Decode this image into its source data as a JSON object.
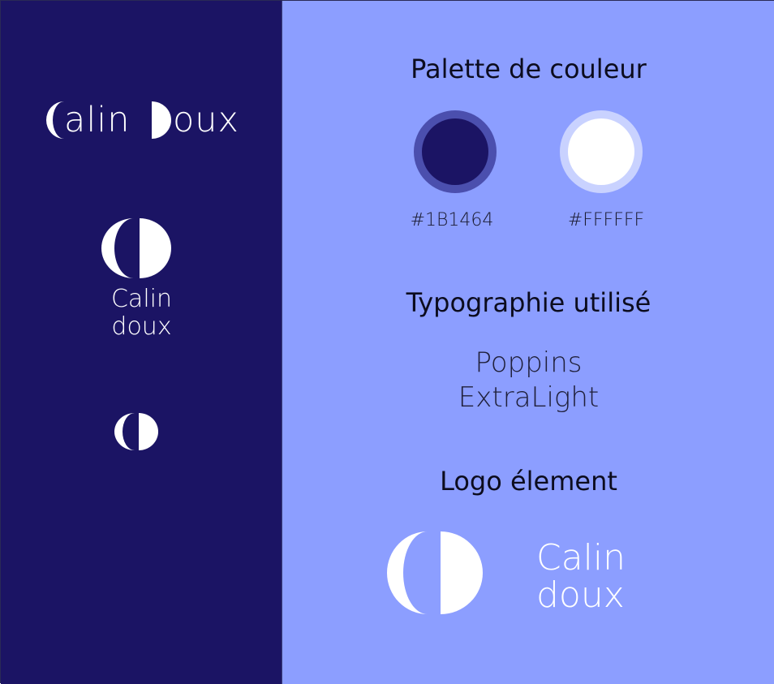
{
  "brand": {
    "name_line": [
      "alin",
      "oux"
    ],
    "stacked_lines": [
      "Calin",
      "doux"
    ]
  },
  "palette": {
    "heading": "Palette de couleur",
    "swatches": [
      {
        "hex_label": "#1B1464",
        "color": "#1B1464",
        "ring": "#4B4FAE"
      },
      {
        "hex_label": "#FFFFFF",
        "color": "#FFFFFF",
        "ring": "#C9D2FF"
      }
    ]
  },
  "typography": {
    "heading": "Typographie utilisé",
    "font_lines": [
      "Poppins",
      "ExtraLight"
    ]
  },
  "logo": {
    "heading": "Logo élement",
    "text_lines": [
      "Calin",
      "doux"
    ]
  },
  "colors": {
    "left_panel": "#1B1464",
    "right_panel": "#8C9EFF",
    "mark": "#FFFFFF"
  },
  "icons": [
    "crescent-left-icon",
    "half-disc-right-icon"
  ]
}
